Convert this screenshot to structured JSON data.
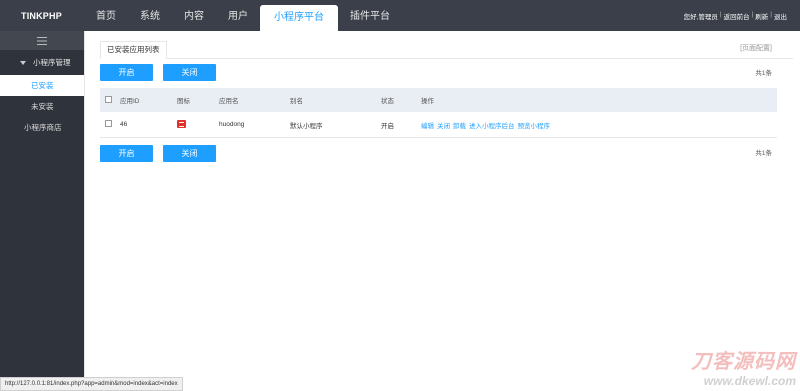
{
  "header": {
    "brand": "TINKPHP",
    "nav": [
      "首页",
      "系统",
      "内容",
      "用户",
      "小程序平台",
      "插件平台"
    ],
    "active_nav_index": 4,
    "user_links": [
      "您好,管理员",
      "返回前台",
      "刷新",
      "退出"
    ]
  },
  "sidebar": {
    "group_label": "小程序管理",
    "items": [
      "已安装",
      "未安装"
    ],
    "store_label": "小程序商店"
  },
  "main": {
    "tab_label": "已安装应用列表",
    "page_config": "[页面配置]",
    "open_button": "开启",
    "close_button": "关闭",
    "count_text": "共1条",
    "table": {
      "headers": [
        "应用ID",
        "图标",
        "应用名",
        "别名",
        "状态",
        "操作"
      ],
      "rows": [
        {
          "id": "46",
          "name": "huodong",
          "alias": "默认小程序",
          "status": "开启",
          "ops": [
            "编辑",
            "关闭",
            "卸载",
            "进入小程序后台",
            "预览小程序"
          ]
        }
      ]
    }
  },
  "statusbar": {
    "url": "http://127.0.0.1:81/index.php?app=admin&mod=index&act=index"
  },
  "watermark": {
    "line1": "刀客源码网",
    "line2": "www.dkewl.com"
  },
  "colors": {
    "accent": "#1e9fff",
    "topbar": "#3a3f4a",
    "sidebar": "#2f333b",
    "table_head": "#e9eef5"
  }
}
